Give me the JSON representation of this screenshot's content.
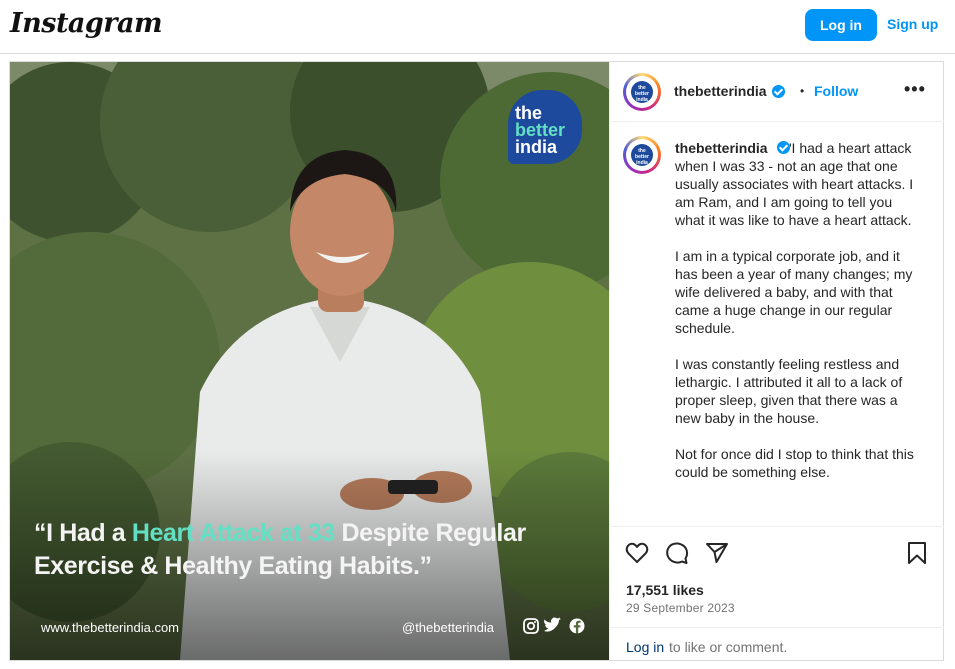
{
  "header": {
    "logo_text": "Instagram",
    "login_label": "Log in",
    "signup_label": "Sign up"
  },
  "post": {
    "username": "thebetterindia",
    "verified": true,
    "follow_label": "Follow",
    "dot": "•",
    "more_icon": "more-horizontal-icon",
    "media": {
      "badge_lines": [
        "the",
        "better",
        "india"
      ],
      "headline_parts": {
        "open": "“I Had a ",
        "highlight": "Heart Attack at 33",
        "rest": " Despite Regular Exercise & Healthy Eating Habits.”"
      },
      "website": "www.thebetterindia.com",
      "handle": "@thebetterindia",
      "social_icons": [
        "instagram-icon",
        "twitter-icon",
        "facebook-icon"
      ]
    },
    "caption": {
      "username": "thebetterindia",
      "paragraphs": [
        "\"I had a heart attack when I was 33 - not an age that one usually associates with heart attacks. I am Ram, and I am going to tell you what it was like to have a heart attack.",
        "I am in a typical corporate job, and it has been a year of many changes; my wife delivered a baby, and with that came a huge change in our regular schedule.",
        "I was constantly feeling restless and lethargic. I attributed it all to a lack of proper sleep, given that there was a new baby in the house.",
        "Not for once did I stop to think that this could be something else."
      ]
    },
    "actions": [
      "heart-icon",
      "comment-icon",
      "share-icon",
      "bookmark-icon"
    ],
    "likes": "17,551 likes",
    "date": "29 September 2023",
    "comment_login": "Log in",
    "comment_rest": "to like or comment."
  },
  "colors": {
    "accent": "#0095f6",
    "brand_blue": "#1d4a9c",
    "brand_teal": "#63e0c4"
  }
}
